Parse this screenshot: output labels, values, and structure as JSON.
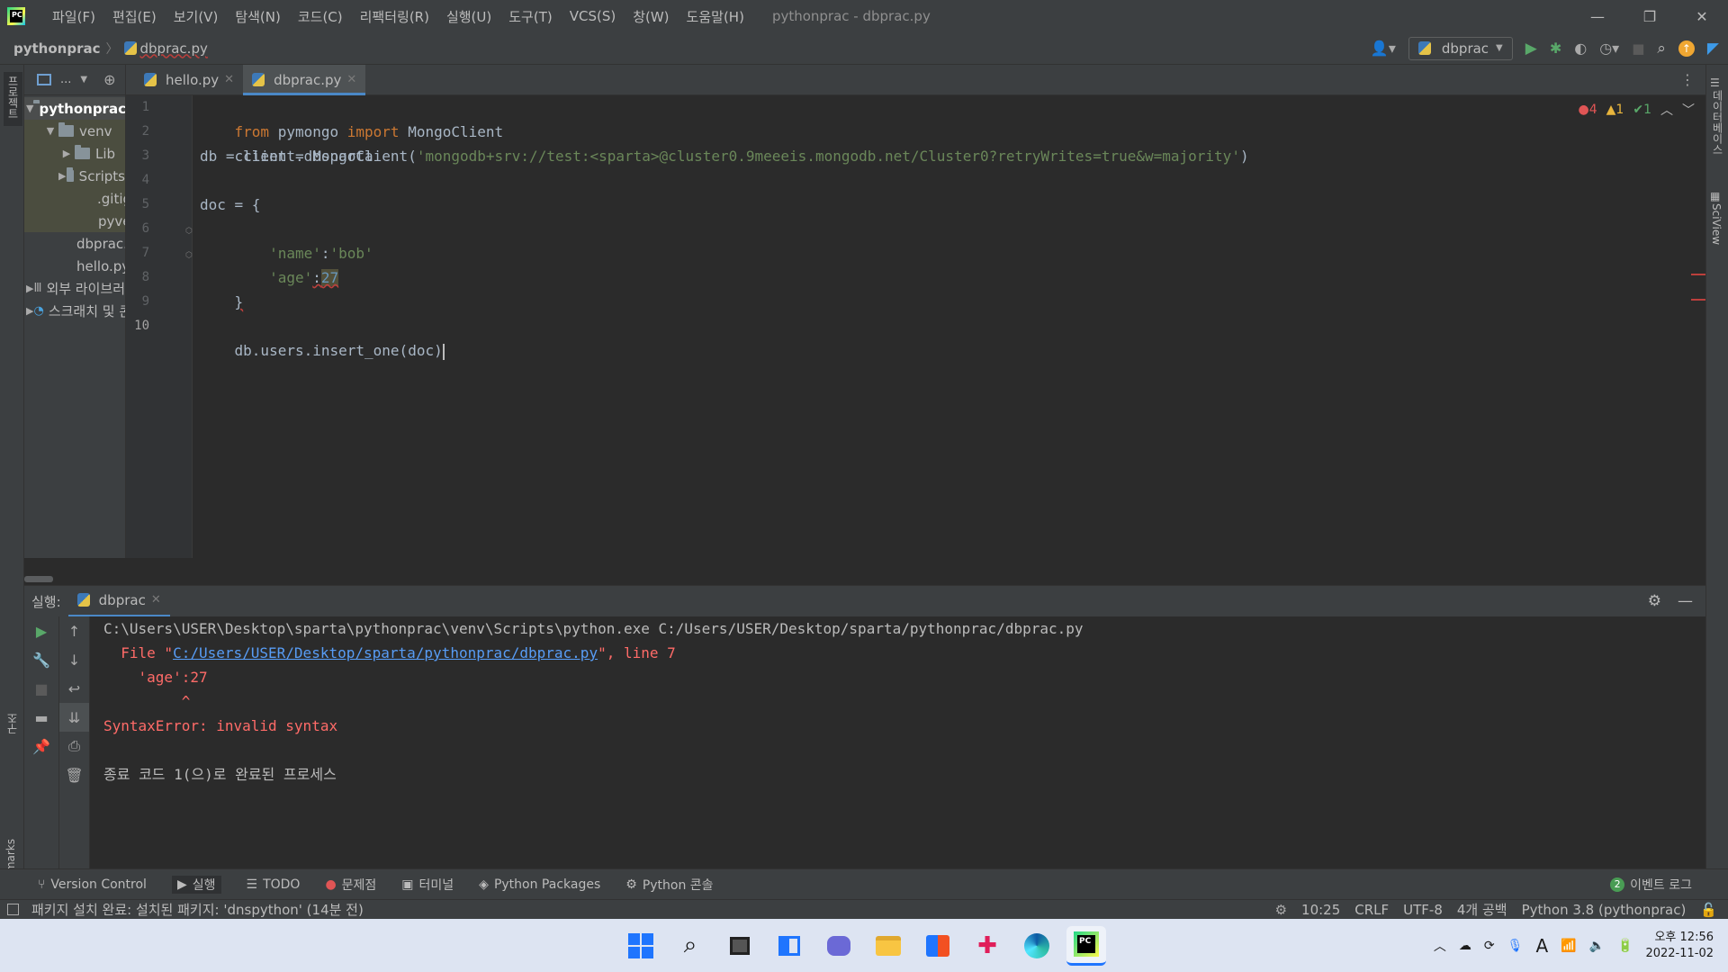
{
  "titlebar": {
    "menu": [
      "파일(F)",
      "편집(E)",
      "보기(V)",
      "탐색(N)",
      "코드(C)",
      "리팩터링(R)",
      "실행(U)",
      "도구(T)",
      "VCS(S)",
      "창(W)",
      "도움말(H)"
    ],
    "title": "pythonprac - dbprac.py"
  },
  "navbar": {
    "project": "pythonprac",
    "file": "dbprac.py",
    "run_config": "dbprac"
  },
  "left_stripe": {
    "project_label": "프로젝트",
    "structure_label": "구조",
    "bookmarks_label": "Bookmarks"
  },
  "right_stripe": {
    "database_label": "데이터베이스",
    "sciview_label": "SciView"
  },
  "project_tree": {
    "toolbar_label": "...",
    "items": [
      {
        "label": "pythonprac",
        "indent": 0,
        "type": "folder",
        "expanded": true
      },
      {
        "label": "venv",
        "indent": 1,
        "type": "folder",
        "expanded": true
      },
      {
        "label": "Lib",
        "indent": 2,
        "type": "folder",
        "expanded": false
      },
      {
        "label": "Scripts",
        "indent": 2,
        "type": "folder",
        "expanded": false
      },
      {
        "label": ".gitignore",
        "indent": 2,
        "type": "file"
      },
      {
        "label": "pyvenv.cfg",
        "indent": 2,
        "type": "cfg"
      },
      {
        "label": "dbprac.py",
        "indent": 1,
        "type": "py"
      },
      {
        "label": "hello.py",
        "indent": 1,
        "type": "py"
      },
      {
        "label": "외부 라이브러리",
        "indent": 0,
        "type": "lib",
        "expanded": false
      },
      {
        "label": "스크래치 및 콘솔",
        "indent": 0,
        "type": "scratch",
        "expanded": false
      }
    ]
  },
  "editor_tabs": [
    {
      "label": "hello.py",
      "active": false
    },
    {
      "label": "dbprac.py",
      "active": true
    }
  ],
  "inspections": {
    "errors": "4",
    "warnings": "1",
    "ok": "1"
  },
  "code": {
    "line_numbers": [
      "1",
      "2",
      "3",
      "4",
      "5",
      "6",
      "7",
      "8",
      "9",
      "10"
    ],
    "l1": {
      "kw1": "from",
      "mod": " pymongo ",
      "kw2": "import",
      "name": " MongoClient"
    },
    "l2": {
      "pre": "client = MongoClient(",
      "str": "'mongodb+srv://test:<sparta>@cluster0.9meeeis.mongodb.net/Cluster0?retryWrites=true&w=majority'",
      "post": ")"
    },
    "l3": "db = client.dbsparta",
    "l5": "doc = {",
    "l6": {
      "indent": "    ",
      "key": "'name'",
      "sep": ":",
      "val": "'bob'"
    },
    "l7": {
      "indent": "    ",
      "key": "'age'",
      "sep": ":",
      "val": "27"
    },
    "l8": "}",
    "l10": "db.users.insert_one(doc)"
  },
  "run_panel": {
    "label": "실행:",
    "tab": "dbprac",
    "console": {
      "cmd": "C:\\Users\\USER\\Desktop\\sparta\\pythonprac\\venv\\Scripts\\python.exe C:/Users/USER/Desktop/sparta/pythonprac/dbprac.py",
      "file_pre": "  File \"",
      "file_link": "C:/Users/USER/Desktop/sparta/pythonprac/dbprac.py",
      "file_post": "\", line 7",
      "src": "    'age':27",
      "caret": "         ^",
      "error": "SyntaxError: invalid syntax",
      "exit": "종료 코드 1(으)로 완료된 프로세스"
    }
  },
  "tool_windows": [
    {
      "name": "version-control",
      "label": "Version Control"
    },
    {
      "name": "run",
      "label": "실행"
    },
    {
      "name": "todo",
      "label": "TODO"
    },
    {
      "name": "problems",
      "label": "문제점"
    },
    {
      "name": "terminal",
      "label": "터미널"
    },
    {
      "name": "python-packages",
      "label": "Python Packages"
    },
    {
      "name": "python-console",
      "label": "Python 콘솔"
    }
  ],
  "event_log": {
    "count": "2",
    "label": "이벤트 로그"
  },
  "statusbar": {
    "message": "패키지 설치 완료: 설치된 패키지: 'dnspython' (14분 전)",
    "position": "10:25",
    "line_sep": "CRLF",
    "encoding": "UTF-8",
    "indent": "4개 공백",
    "interpreter": "Python 3.8 (pythonprac)"
  },
  "taskbar": {
    "ampm_time": "오후 12:56",
    "date": "2022-11-02",
    "ime": "A"
  },
  "colors": {
    "keyword": "#cc7832",
    "string": "#6a8759",
    "number": "#6897bb",
    "error": "#ff6b68",
    "link": "#589df6",
    "accent": "#4a88c7"
  }
}
